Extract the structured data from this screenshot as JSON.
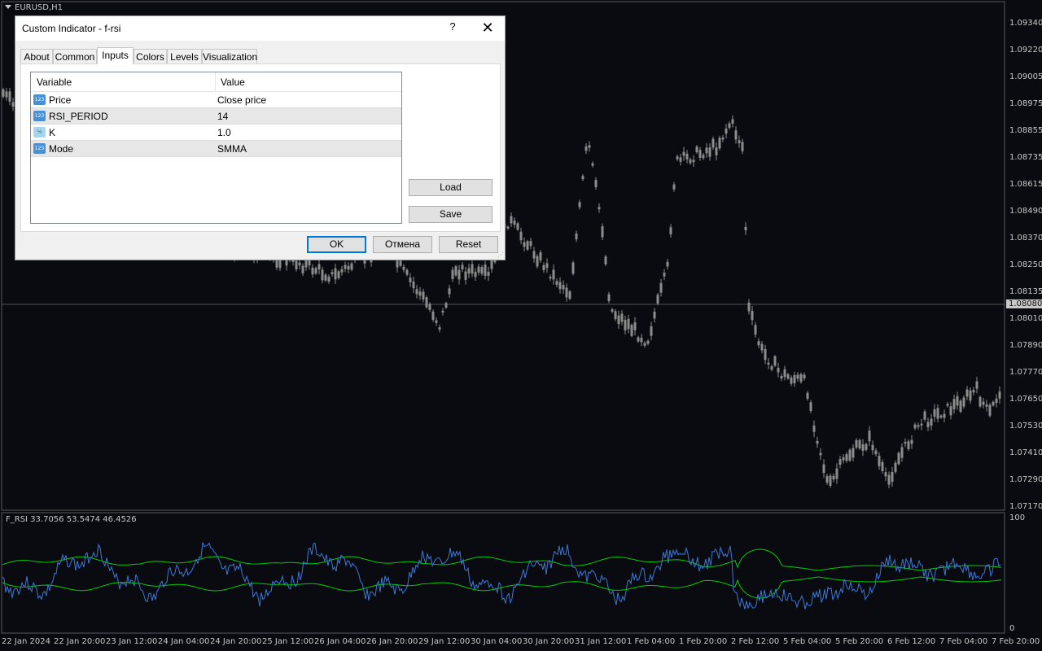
{
  "chart": {
    "title": "EURUSD,H1",
    "indicator_label": "F_RSI 33.7056 53.5474 46.4526",
    "current_price": "1.08080",
    "price_ticks": [
      "1.09340",
      "1.09220",
      "1.09005",
      "1.08975",
      "1.08855",
      "1.08735",
      "1.08615",
      "1.08490",
      "1.08370",
      "1.08250",
      "1.08135",
      "1.08010",
      "1.07890",
      "1.07770",
      "1.07650",
      "1.07530",
      "1.07410",
      "1.07290",
      "1.07170"
    ],
    "indicator_ticks": [
      "100",
      "0"
    ],
    "time_ticks": [
      "22 Jan 2024",
      "22 Jan 20:00",
      "23 Jan 12:00",
      "24 Jan 04:00",
      "24 Jan 20:00",
      "25 Jan 12:00",
      "26 Jan 04:00",
      "26 Jan 20:00",
      "29 Jan 12:00",
      "30 Jan 04:00",
      "30 Jan 20:00",
      "31 Jan 12:00",
      "1 Feb 04:00",
      "1 Feb 20:00",
      "2 Feb 12:00",
      "5 Feb 04:00",
      "5 Feb 20:00",
      "6 Feb 12:00",
      "7 Feb 04:00",
      "7 Feb 20:00"
    ],
    "colors": {
      "background": "#0a0b10",
      "candle": "#8c8c8c",
      "rsi_line": "#3c78d8",
      "band_lines": "#00d000",
      "grid_line": "#5a5a5a"
    }
  },
  "dialog": {
    "title": "Custom Indicator - f-rsi",
    "help_label": "?",
    "close_label": "✕",
    "tabs": [
      {
        "label": "About",
        "active": false
      },
      {
        "label": "Common",
        "active": false
      },
      {
        "label": "Inputs",
        "active": true
      },
      {
        "label": "Colors",
        "active": false
      },
      {
        "label": "Levels",
        "active": false
      },
      {
        "label": "Visualization",
        "active": false
      }
    ],
    "table": {
      "col_variable": "Variable",
      "col_value": "Value",
      "rows": [
        {
          "icon": "int-param-icon",
          "icon_text": "123",
          "variable": "Price",
          "value": "Close price"
        },
        {
          "icon": "int-param-icon",
          "icon_text": "123",
          "variable": "RSI_PERIOD",
          "value": "14"
        },
        {
          "icon": "double-param-icon",
          "icon_text": "½",
          "variable": "K",
          "value": "1.0"
        },
        {
          "icon": "int-param-icon",
          "icon_text": "123",
          "variable": "Mode",
          "value": "SMMA"
        }
      ]
    },
    "load_label": "Load",
    "save_label": "Save",
    "ok_label": "OK",
    "cancel_label": "Отмена",
    "reset_label": "Reset"
  }
}
